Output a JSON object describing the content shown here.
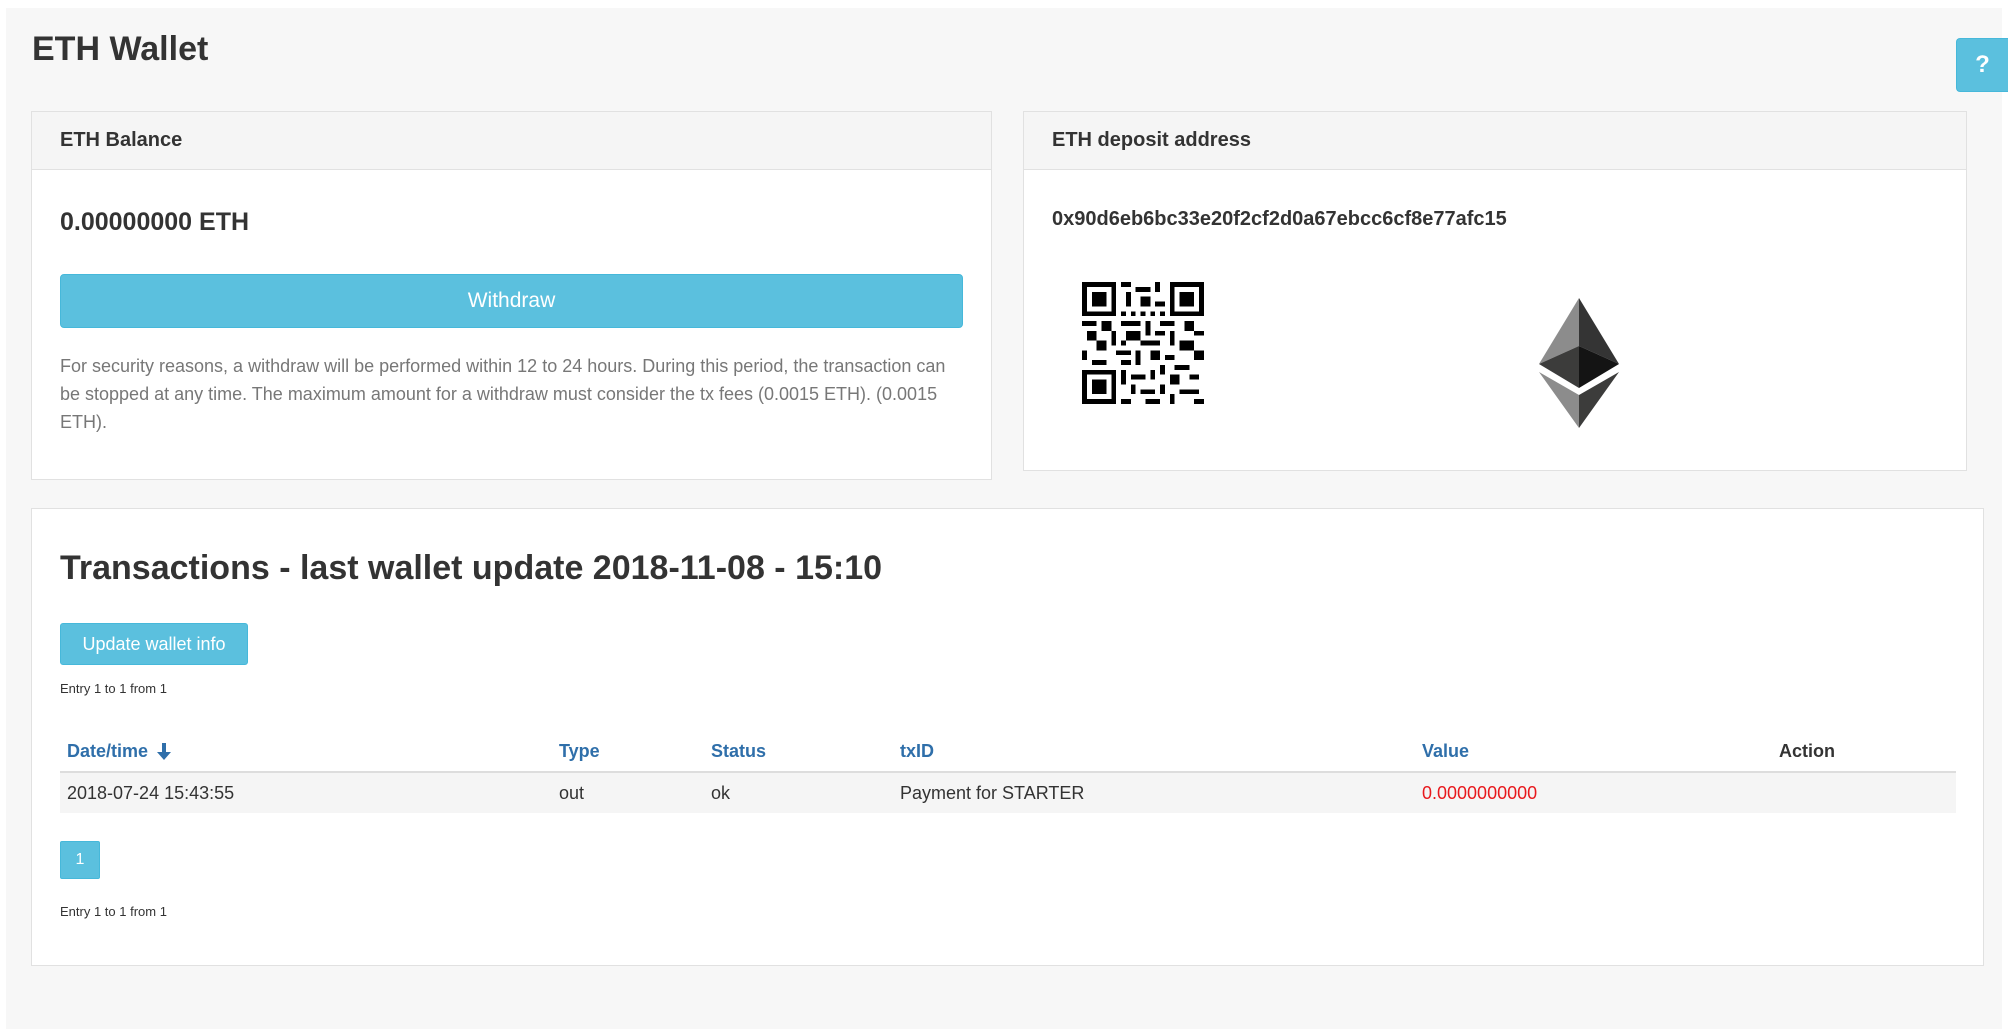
{
  "page": {
    "title": "ETH Wallet",
    "help_label": "?"
  },
  "balance": {
    "heading": "ETH Balance",
    "amount": "0.00000000 ETH",
    "withdraw_label": "Withdraw",
    "note": "For security reasons, a withdraw will be performed within 12 to 24 hours. During this period, the transaction can be stopped at any time. The maximum amount for a withdraw must consider the tx fees (0.0015 ETH). (0.0015 ETH)."
  },
  "deposit": {
    "heading": "ETH deposit address",
    "address": "0x90d6eb6bc33e20f2cf2d0a67ebcc6cf8e77afc15",
    "qr_icon": "qr-code-icon",
    "logo_icon": "ethereum-logo-icon"
  },
  "transactions": {
    "title": "Transactions - last wallet update 2018-11-08 - 15:10",
    "update_label": "Update wallet info",
    "entry_info": "Entry 1 to 1 from 1",
    "columns": {
      "datetime": "Date/time",
      "type": "Type",
      "status": "Status",
      "txid": "txID",
      "value": "Value",
      "action": "Action"
    },
    "sort_icon": "arrow-down-icon",
    "rows": [
      {
        "datetime": "2018-07-24 15:43:55",
        "type": "out",
        "status": "ok",
        "txid": "Payment for STARTER",
        "value": "0.0000000000",
        "action": ""
      }
    ],
    "pagination": {
      "current_page": "1"
    }
  },
  "colors": {
    "accent": "#5bc0de",
    "link": "#2f6faa",
    "negative_value": "#e8191d"
  }
}
